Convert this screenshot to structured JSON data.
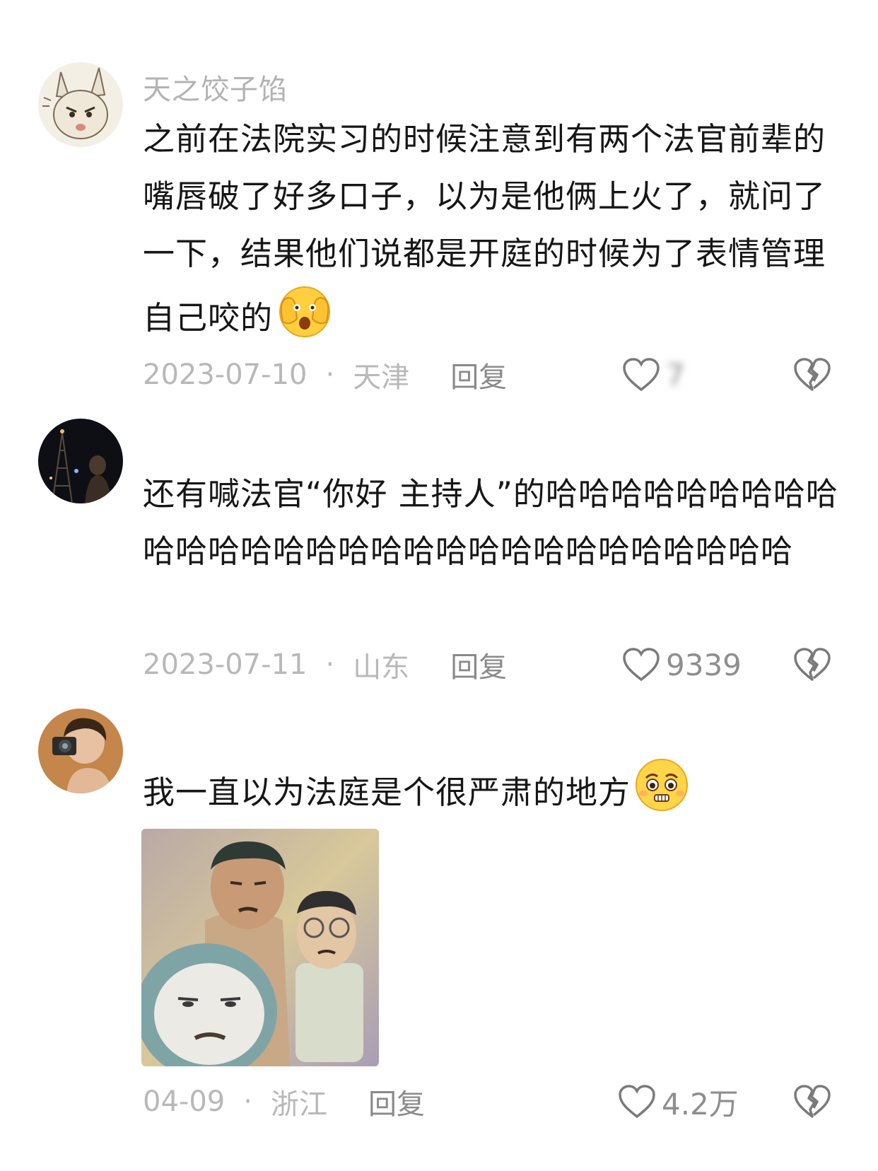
{
  "comments": [
    {
      "username": "天之饺子馅",
      "text": "之前在法院实习的时候注意到有两个法官前辈的嘴唇破了好多口子，以为是他俩上火了，就问了一下，结果他们说都是开庭的时候为了表情管理自己咬的",
      "date": "2023-07-10",
      "location": "天津",
      "reply_label": "回复",
      "likes": "7",
      "emoji": "hands-over-face-emoji"
    },
    {
      "username": "",
      "text": "还有喊法官“你好 主持人”的哈哈哈哈哈哈哈哈哈哈哈哈哈哈哈哈哈哈哈哈哈哈哈哈哈哈哈哈哈",
      "date": "2023-07-11",
      "location": "山东",
      "reply_label": "回复",
      "likes": "9339"
    },
    {
      "username": "",
      "text": "我一直以为法庭是个很严肃的地方",
      "date": "04-09",
      "location": "浙江",
      "reply_label": "回复",
      "likes": "4.2万",
      "emoji": "pleading-face-emoji",
      "sticker": "meme-sticker-image"
    }
  ],
  "separator": "·",
  "icons": {
    "like": "heart-outline-icon",
    "dislike": "broken-heart-icon"
  },
  "colors": {
    "text": "#161616",
    "meta": "#b8b8b8",
    "reply": "#8a8a8a",
    "icon": "#7a7a7a"
  }
}
